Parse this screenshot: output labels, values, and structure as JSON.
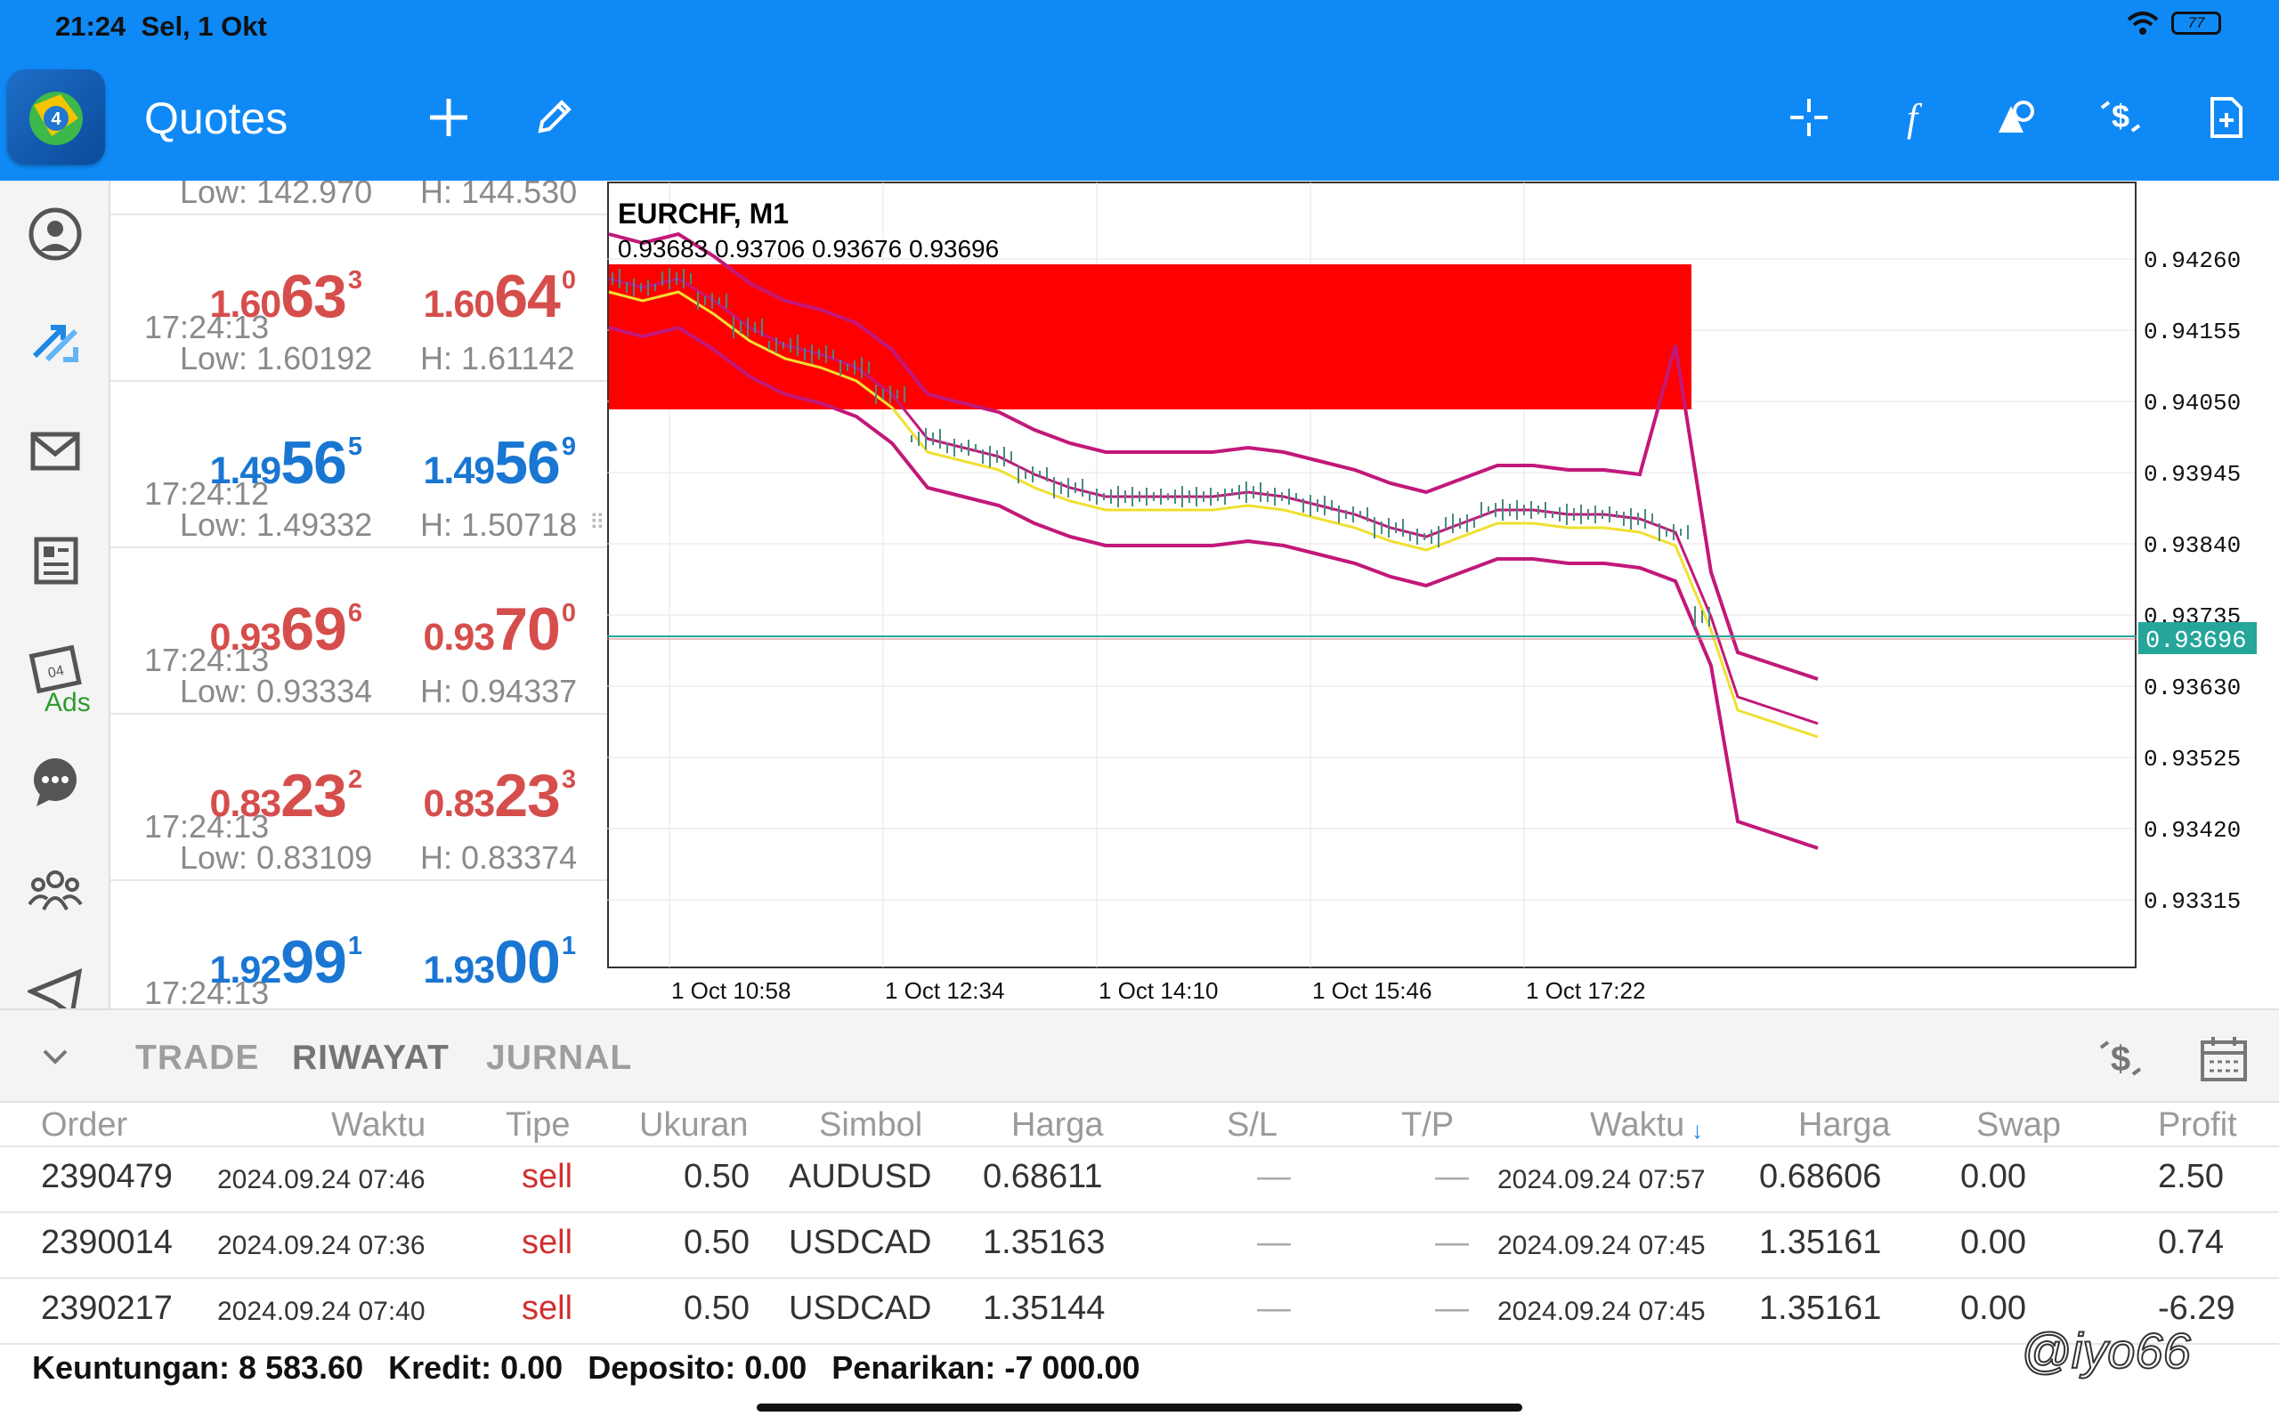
{
  "status_bar": {
    "time": "21:24",
    "date": "Sel, 1 Okt",
    "battery": "77"
  },
  "toolbar": {
    "title": "Quotes",
    "icons": [
      "plus-icon",
      "pencil-icon",
      "crosshair-icon",
      "function-icon",
      "shapes-icon",
      "dollar-trade-icon",
      "new-document-icon"
    ]
  },
  "sidebar": {
    "items": [
      "quotes-icon",
      "trade-icon",
      "mail-icon",
      "news-icon",
      "calendar-icon",
      "chat-icon",
      "community-icon",
      "telegram-icon"
    ],
    "ads_label": "Ads"
  },
  "quotes": {
    "partial_top": {
      "low": "Low: 142.970",
      "high": "H: 144.530"
    },
    "rows": [
      {
        "time": "17:24:13",
        "dir": "down",
        "bid_a": "1.60",
        "bid_b": "63",
        "bid_c": "3",
        "ask_a": "1.60",
        "ask_b": "64",
        "ask_c": "0",
        "low": "Low: 1.60192",
        "high": "H: 1.61142"
      },
      {
        "time": "17:24:12",
        "dir": "up",
        "bid_a": "1.49",
        "bid_b": "56",
        "bid_c": "5",
        "ask_a": "1.49",
        "ask_b": "56",
        "ask_c": "9",
        "low": "Low: 1.49332",
        "high": "H: 1.50718"
      },
      {
        "time": "17:24:13",
        "dir": "down",
        "bid_a": "0.93",
        "bid_b": "69",
        "bid_c": "6",
        "ask_a": "0.93",
        "ask_b": "70",
        "ask_c": "0",
        "low": "Low: 0.93334",
        "high": "H: 0.94337"
      },
      {
        "time": "17:24:13",
        "dir": "down",
        "bid_a": "0.83",
        "bid_b": "23",
        "bid_c": "2",
        "ask_a": "0.83",
        "ask_b": "23",
        "ask_c": "3",
        "low": "Low: 0.83109",
        "high": "H: 0.83374"
      },
      {
        "time": "17:24:13",
        "dir": "up",
        "bid_a": "1.92",
        "bid_b": "99",
        "bid_c": "1",
        "ask_a": "1.93",
        "ask_b": "00",
        "ask_c": "1",
        "low": "",
        "high": ""
      }
    ]
  },
  "chart": {
    "symbol": "EURCHF, M1",
    "ohlc": "0.93683 0.93706 0.93676 0.93696",
    "current_price": "0.93696",
    "y_labels": [
      "0.94260",
      "0.94155",
      "0.94050",
      "0.93945",
      "0.93840",
      "0.93735",
      "0.93630",
      "0.93525",
      "0.93420",
      "0.93315"
    ],
    "x_labels": [
      "1 Oct 10:58",
      "1 Oct 12:34",
      "1 Oct 14:10",
      "1 Oct 15:46",
      "1 Oct 17:22"
    ],
    "zone_color": "#ff0000",
    "band_color": "#c2187a",
    "ma_color": "#f0e030",
    "price_line_color": "#26a69a"
  },
  "history": {
    "tabs": [
      "TRADE",
      "RIWAYAT",
      "JURNAL"
    ],
    "active_tab": "RIWAYAT",
    "headers": [
      "Order",
      "Waktu",
      "Tipe",
      "Ukuran",
      "Simbol",
      "Harga",
      "S/L",
      "T/P",
      "Waktu",
      "Harga",
      "Swap",
      "Profit"
    ],
    "sort_arrow": "↓",
    "rows": [
      {
        "order": "2390479",
        "open_time": "2024.09.24 07:46",
        "type": "sell",
        "size": "0.50",
        "symbol": "AUDUSD",
        "open_price": "0.68611",
        "sl": "—",
        "tp": "—",
        "close_time": "2024.09.24 07:57",
        "close_price": "0.68606",
        "swap": "0.00",
        "profit": "2.50"
      },
      {
        "order": "2390014",
        "open_time": "2024.09.24 07:36",
        "type": "sell",
        "size": "0.50",
        "symbol": "USDCAD",
        "open_price": "1.35163",
        "sl": "—",
        "tp": "—",
        "close_time": "2024.09.24 07:45",
        "close_price": "1.35161",
        "swap": "0.00",
        "profit": "0.74"
      },
      {
        "order": "2390217",
        "open_time": "2024.09.24 07:40",
        "type": "sell",
        "size": "0.50",
        "symbol": "USDCAD",
        "open_price": "1.35144",
        "sl": "—",
        "tp": "—",
        "close_time": "2024.09.24 07:45",
        "close_price": "1.35161",
        "swap": "0.00",
        "profit": "-6.29"
      }
    ],
    "summary": {
      "profit": "Keuntungan: 8 583.60",
      "credit": "Kredit: 0.00",
      "deposit": "Deposito: 0.00",
      "withdrawal": "Penarikan: -7 000.00"
    }
  },
  "watermark": "@iyo66"
}
